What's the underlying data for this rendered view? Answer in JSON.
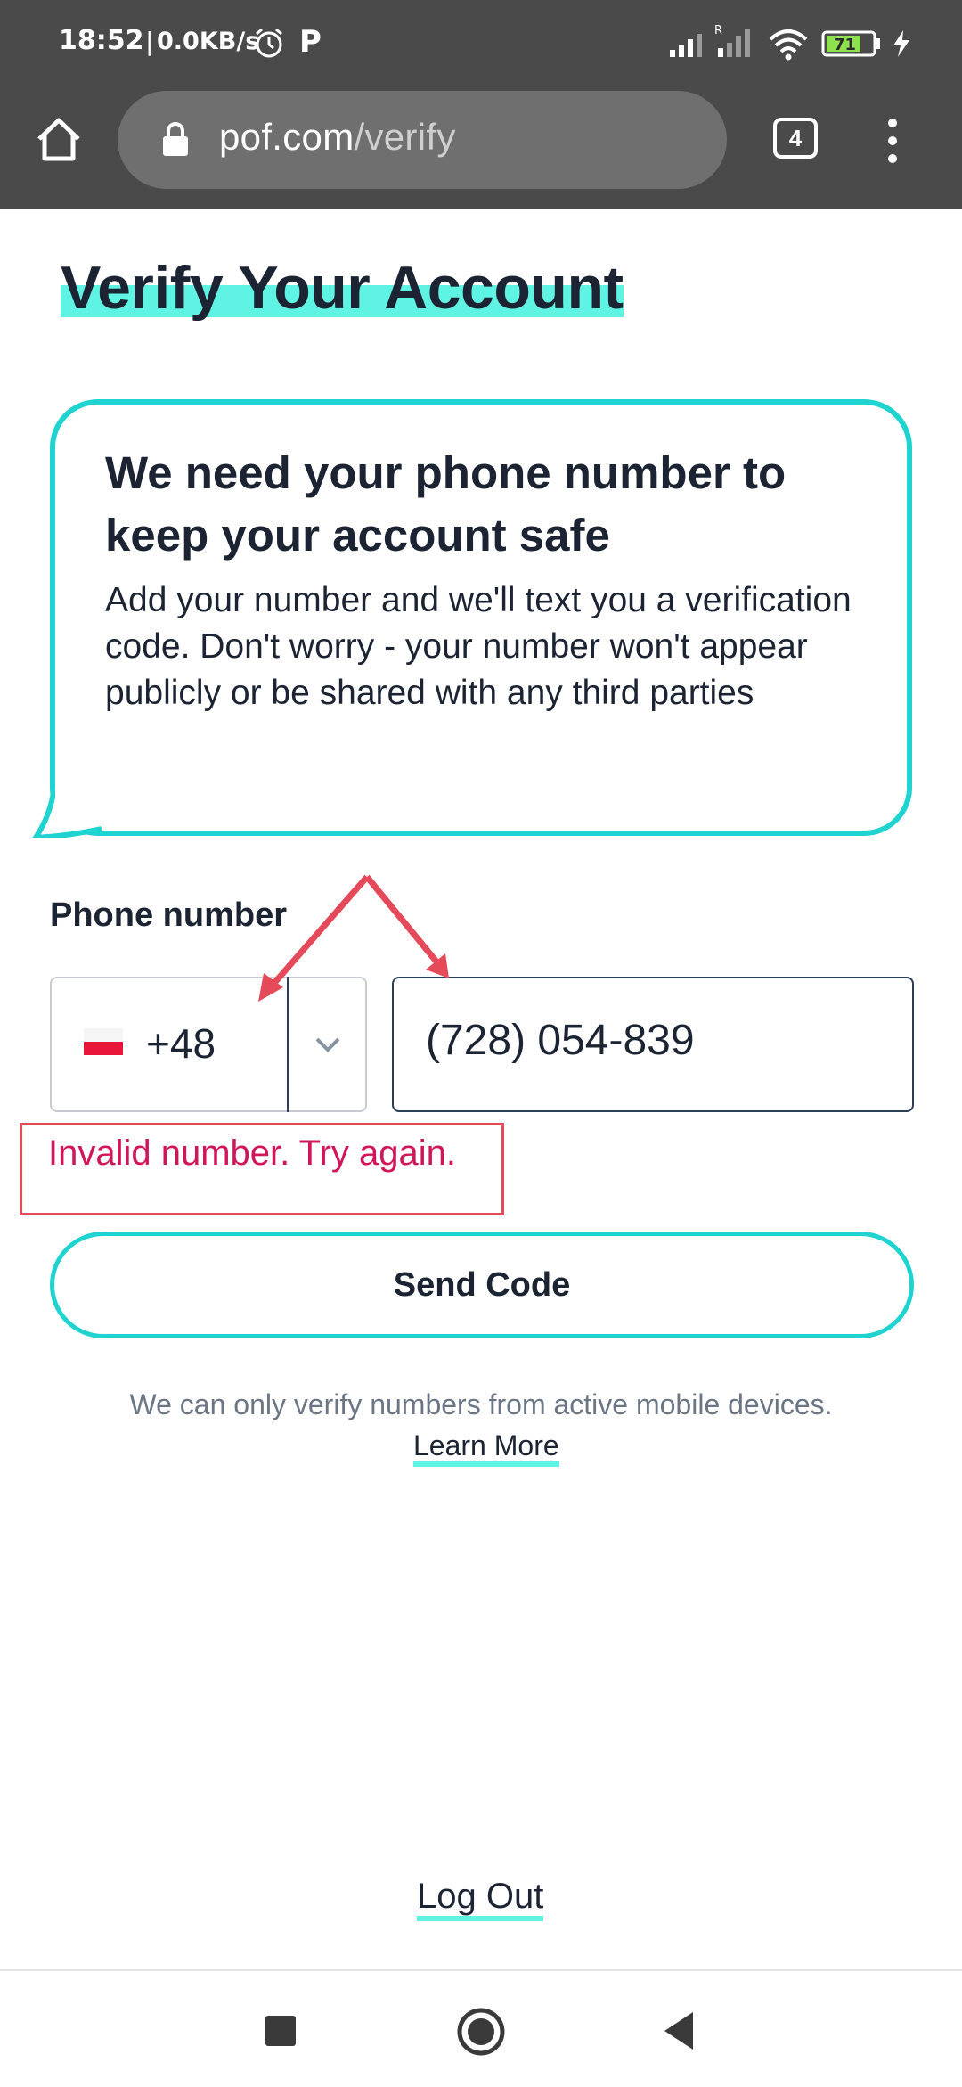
{
  "status_bar": {
    "time": "18:52",
    "separator": "|",
    "network_speed": "0.0KB/s",
    "carrier_icon_letter": "P",
    "roaming_indicator": "R",
    "battery_level": "71"
  },
  "browser": {
    "url_domain": "pof.com",
    "url_path": "/verify",
    "tab_count": "4"
  },
  "page": {
    "title": "Verify Your Account",
    "card": {
      "heading": "We need your phone number to keep your account safe",
      "body": "Add your number and we'll text you a verification code. Don't worry - your number won't appear publicly or be shared with any third parties"
    },
    "phone_label": "Phone number",
    "country": {
      "dial_code": "+48",
      "flag": "poland-flag"
    },
    "phone_value": "(728) 054-839",
    "error": "Invalid number. Try again.",
    "send_button": "Send Code",
    "note": "We can only verify numbers from active mobile devices.",
    "learn_more": "Learn More",
    "logout": "Log Out"
  },
  "colors": {
    "accent_teal": "#1fd3d0",
    "highlight": "#5ff3e3",
    "error": "#d0155a",
    "annotation_red": "#e54a5a",
    "text_dark": "#1c2433",
    "chrome_bar": "#4a4a4a"
  },
  "icons": [
    "alarm-icon",
    "signal-icon",
    "wifi-icon",
    "battery-icon",
    "charging-icon",
    "home-icon",
    "lock-icon",
    "tabs-icon",
    "menu-icon",
    "chevron-down-icon",
    "recents-icon",
    "nav-home-icon",
    "back-icon"
  ]
}
